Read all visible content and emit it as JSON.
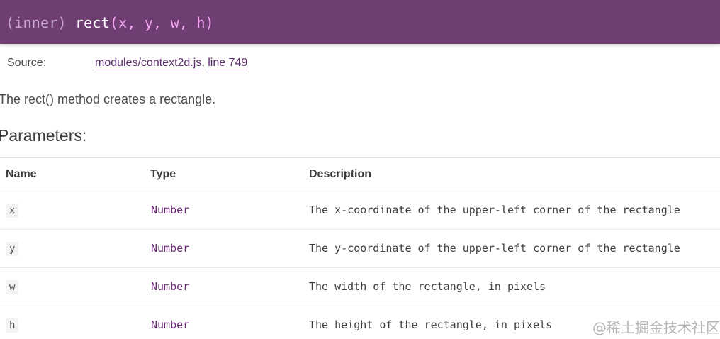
{
  "method": {
    "attribute": "(inner)",
    "name": "rect",
    "params": "(x, y, w, h)"
  },
  "source": {
    "label": "Source:",
    "file": "modules/context2d.js",
    "separator": ", ",
    "line": "line 749"
  },
  "description": "The rect() method creates a rectangle.",
  "parameters": {
    "heading": "Parameters:",
    "columns": [
      "Name",
      "Type",
      "Description"
    ],
    "rows": [
      {
        "name": "x",
        "type": "Number",
        "description": "The x-coordinate of the upper-left corner of the rectangle"
      },
      {
        "name": "y",
        "type": "Number",
        "description": "The y-coordinate of the upper-left corner of the rectangle"
      },
      {
        "name": "w",
        "type": "Number",
        "description": "The width of the rectangle, in pixels"
      },
      {
        "name": "h",
        "type": "Number",
        "description": "The height of the rectangle, in pixels"
      }
    ]
  },
  "watermark": "@稀土掘金技术社区",
  "colors": {
    "banner": "#6f3f73",
    "type_text": "#6b2a75",
    "link": "#5b2a6a"
  }
}
